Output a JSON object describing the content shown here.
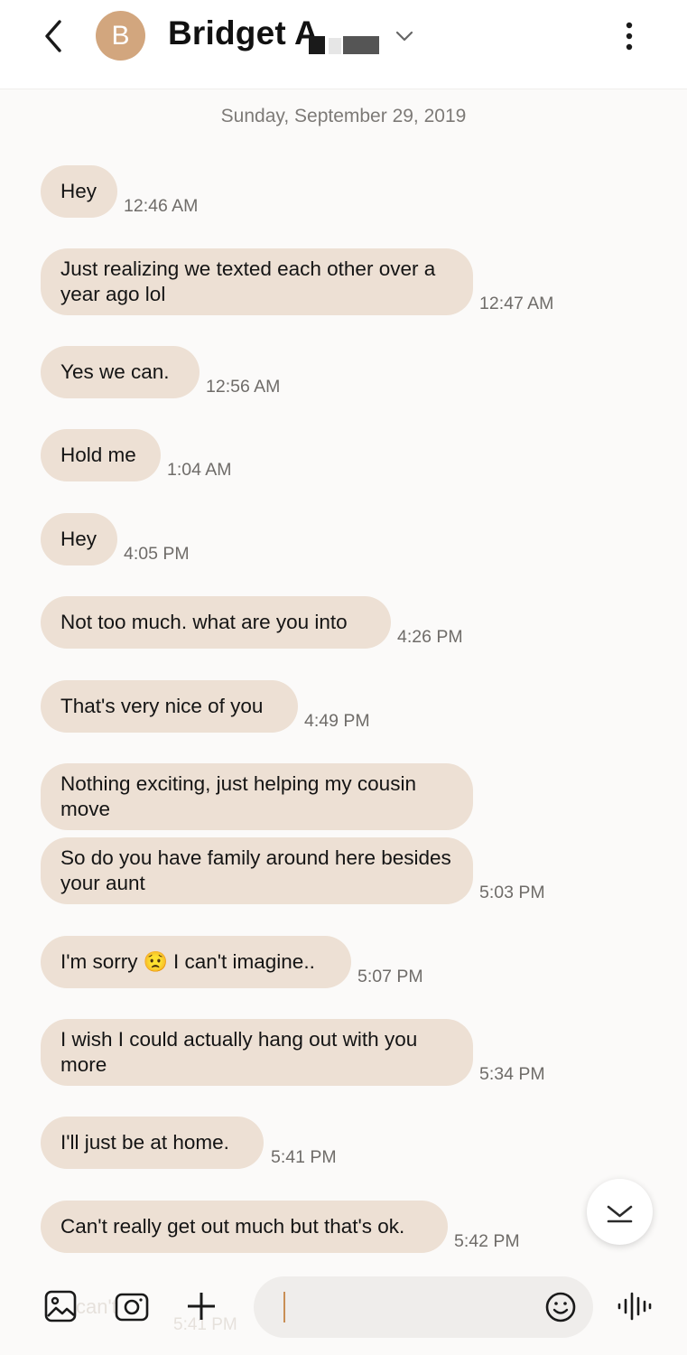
{
  "header": {
    "back_icon": "back-arrow-icon",
    "avatar_initial": "B",
    "contact_name": "Bridget A",
    "dropdown_icon": "chevron-down-icon",
    "menu_icon": "more-vertical-icon"
  },
  "conversation": {
    "date": "Sunday, September 29, 2019",
    "messages": [
      {
        "text": "Hey",
        "time": "12:46 AM"
      },
      {
        "text": "Just realizing we texted each other over a year ago lol",
        "time": "12:47 AM"
      },
      {
        "text": "Yes we can.",
        "time": "12:56 AM"
      },
      {
        "text": "Hold me",
        "time": "1:04 AM"
      },
      {
        "text": "Hey",
        "time": "4:05 PM"
      },
      {
        "text": "Not too much. what are you into",
        "time": "4:26 PM"
      },
      {
        "text": "That's very nice of you",
        "time": "4:49 PM"
      },
      {
        "text": "Nothing exciting, just helping my cousin move",
        "time": ""
      },
      {
        "text": "So do you have family around here besides your aunt",
        "time": "5:03 PM"
      },
      {
        "text_before": "I'm sorry",
        "emoji": "😟",
        "text_after": "I can't imagine..",
        "time": "5:07 PM"
      },
      {
        "text": "I wish I could actually hang out with you more",
        "time": "5:34 PM"
      },
      {
        "text": "I'll just be at home.",
        "time": "5:41 PM"
      },
      {
        "text": "Can't really get out much but that's ok.",
        "time": "5:42 PM"
      }
    ],
    "scroll_down_icon": "chevron-down-icon"
  },
  "composer": {
    "ghost_text": "can't",
    "ghost_time": "5:41 PM",
    "gallery_icon": "image-icon",
    "camera_icon": "camera-icon",
    "add_icon": "plus-icon",
    "emoji_icon": "emoji-icon",
    "voice_icon": "voice-waveform-icon"
  },
  "colors": {
    "bubble": "#ede0d4",
    "avatar": "#d2a67e",
    "caret": "#c98e55"
  }
}
